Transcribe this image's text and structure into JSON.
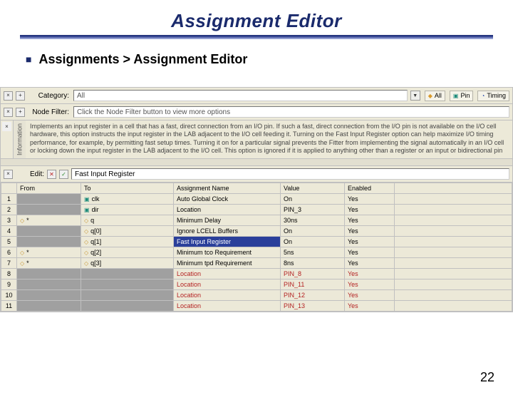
{
  "slide": {
    "title": "Assignment Editor",
    "breadcrumb": "Assignments > Assignment Editor",
    "page_number": "22"
  },
  "category_row": {
    "label": "Category:",
    "value": "All",
    "chips": [
      "All",
      "Pin",
      "Timing"
    ]
  },
  "filter_row": {
    "label": "Node Filter:",
    "placeholder": "Click the Node Filter button to view more options"
  },
  "info": {
    "tab": "Information",
    "text": "Implements an input register in a cell that has a fast, direct connection from an I/O pin. If such a fast, direct connection from the I/O pin is not available on the I/O cell hardware, this option instructs the input register in the LAB adjacent to the I/O cell feeding it. Turning on the Fast Input Register option can help maximize I/O timing performance, for example, by permitting fast setup times. Turning it on for a particular signal prevents the Fitter from implementing the signal automatically in an I/O cell or locking down the input register in the LAB adjacent to the I/O cell. This option is ignored if it is applied to anything other than a register or an input or bidirectional pin that feeds a register."
  },
  "edit": {
    "label": "Edit:",
    "value": "Fast Input Register"
  },
  "columns": [
    "From",
    "To",
    "Assignment Name",
    "Value",
    "Enabled"
  ],
  "rows": [
    {
      "n": "1",
      "from": "",
      "to": "clk",
      "to_icon": "pin",
      "name": "Auto Global Clock",
      "value": "On",
      "enabled": "Yes",
      "shaded": true
    },
    {
      "n": "2",
      "from": "",
      "to": "dir",
      "to_icon": "pin",
      "name": "Location",
      "value": "PIN_3",
      "enabled": "Yes",
      "shaded": true
    },
    {
      "n": "3",
      "from": "*",
      "to": "q",
      "to_icon": "diamond",
      "name": "Minimum Delay",
      "value": "30ns",
      "enabled": "Yes",
      "shaded": false,
      "from_icon": "diamond"
    },
    {
      "n": "4",
      "from": "",
      "to": "q[0]",
      "to_icon": "diamond",
      "name": "Ignore LCELL Buffers",
      "value": "On",
      "enabled": "Yes",
      "shaded": true
    },
    {
      "n": "5",
      "from": "",
      "to": "q[1]",
      "to_icon": "diamond",
      "name": "Fast Input Register",
      "value": "On",
      "enabled": "Yes",
      "shaded": true,
      "selected": true
    },
    {
      "n": "6",
      "from": "*",
      "to": "q[2]",
      "to_icon": "diamond",
      "name": "Minimum tco Requirement",
      "value": "5ns",
      "enabled": "Yes",
      "shaded": false,
      "from_icon": "diamond"
    },
    {
      "n": "7",
      "from": "*",
      "to": "q[3]",
      "to_icon": "diamond",
      "name": "Minimum tpd Requirement",
      "value": "8ns",
      "enabled": "Yes",
      "shaded": false,
      "from_icon": "diamond"
    },
    {
      "n": "8",
      "from": "",
      "to": "",
      "to_icon": "",
      "name": "Location",
      "value": "PIN_8",
      "enabled": "Yes",
      "shaded": true,
      "red": true
    },
    {
      "n": "9",
      "from": "",
      "to": "",
      "to_icon": "",
      "name": "Location",
      "value": "PIN_11",
      "enabled": "Yes",
      "shaded": true,
      "red": true
    },
    {
      "n": "10",
      "from": "",
      "to": "",
      "to_icon": "",
      "name": "Location",
      "value": "PIN_12",
      "enabled": "Yes",
      "shaded": true,
      "red": true
    },
    {
      "n": "11",
      "from": "",
      "to": "",
      "to_icon": "",
      "name": "Location",
      "value": "PIN_13",
      "enabled": "Yes",
      "shaded": true,
      "red": true
    }
  ]
}
